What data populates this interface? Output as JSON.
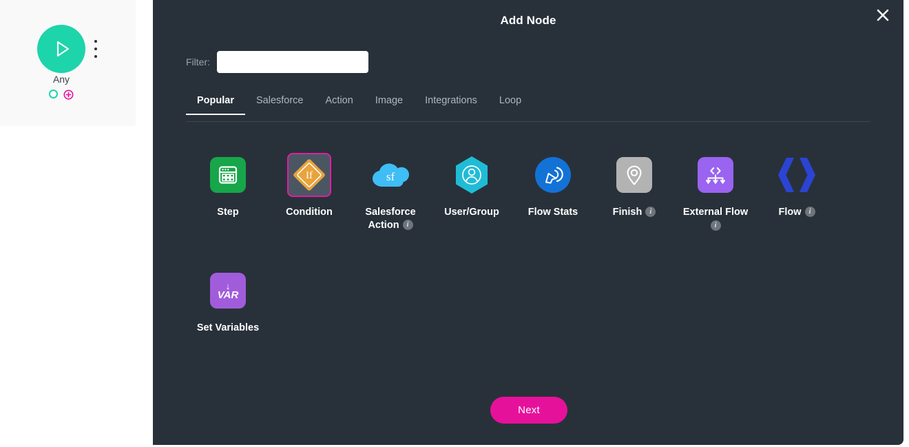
{
  "canvas": {
    "start_node": {
      "label": "Any",
      "play_icon": "play-icon",
      "menu_icon": "kebab-menu-icon",
      "output_handle_icon": "connector-handle-icon",
      "add_handle_icon": "add-connection-icon",
      "accent_color": "#1ed4ab",
      "add_color": "#e6119b"
    }
  },
  "modal": {
    "title": "Add Node",
    "close_icon": "close-icon",
    "filter": {
      "label": "Filter:",
      "value": "",
      "placeholder": ""
    },
    "tabs": [
      {
        "label": "Popular",
        "active": true
      },
      {
        "label": "Salesforce",
        "active": false
      },
      {
        "label": "Action",
        "active": false
      },
      {
        "label": "Image",
        "active": false
      },
      {
        "label": "Integrations",
        "active": false
      },
      {
        "label": "Loop",
        "active": false
      }
    ],
    "nodes": [
      {
        "label": "Step",
        "icon": "step-window-icon",
        "selected": false,
        "info": false,
        "color": "#17a64a"
      },
      {
        "label": "Condition",
        "icon": "condition-if-diamond-icon",
        "selected": true,
        "info": false,
        "color": "#e8a33d"
      },
      {
        "label": "Salesforce Action",
        "icon": "salesforce-cloud-icon",
        "selected": false,
        "info": true,
        "info_inline": true,
        "color": "#3fbdf5"
      },
      {
        "label": "User/Group",
        "icon": "user-group-hexagon-icon",
        "selected": false,
        "info": false,
        "color": "#20bcd6"
      },
      {
        "label": "Flow Stats",
        "icon": "flow-stats-cursor-icon",
        "selected": false,
        "info": false,
        "color": "#1372d6"
      },
      {
        "label": "Finish",
        "icon": "finish-map-pin-icon",
        "selected": false,
        "info": true,
        "info_inline": true,
        "color": "#b3b3b3"
      },
      {
        "label": "External Flow",
        "icon": "external-flow-branch-icon",
        "selected": false,
        "info": true,
        "info_inline": false,
        "color": "#9a63f0"
      },
      {
        "label": "Flow",
        "icon": "flow-brackets-icon",
        "selected": false,
        "info": true,
        "info_inline": true,
        "color": "#2b44d4"
      },
      {
        "label": "Set Variables",
        "icon": "set-variables-var-icon",
        "selected": false,
        "info": false,
        "color": "#a15cdb"
      }
    ],
    "next_button": "Next",
    "info_badge_text": "i",
    "salesforce_icon_text": "sf",
    "condition_icon_text": "If",
    "variables_icon_text": "VAR"
  }
}
